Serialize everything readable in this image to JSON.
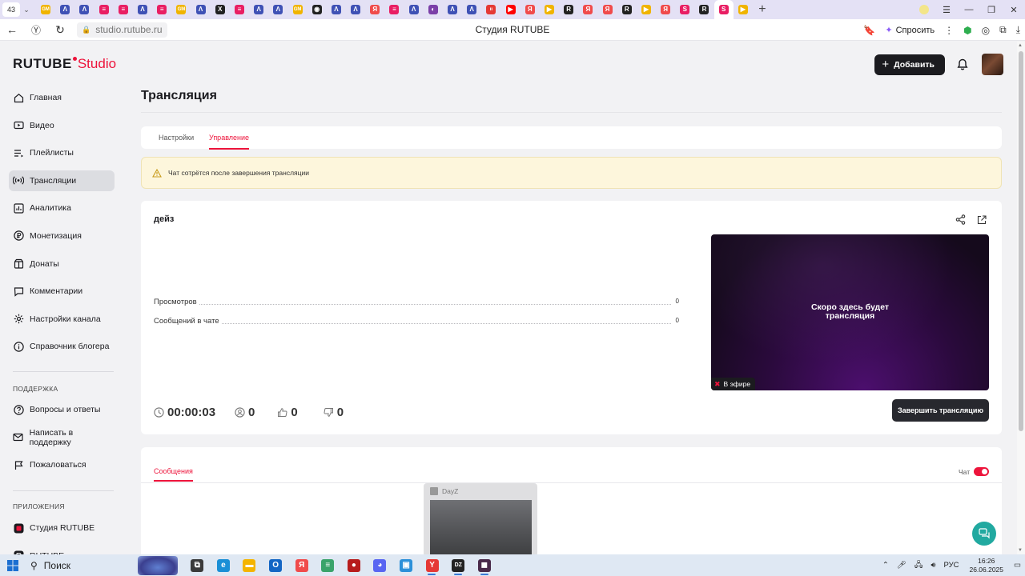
{
  "browser": {
    "tab_counter": "43",
    "tab_icons": [
      {
        "name": "gm-tab-icon",
        "color": "#f0b400",
        "glyph": "GM"
      },
      {
        "name": "dev-tab-icon",
        "color": "#3f51b5",
        "glyph": "Λ"
      },
      {
        "name": "dev-tab-icon",
        "color": "#3f51b5",
        "glyph": "Λ"
      },
      {
        "name": "rutube-tab-icon",
        "color": "#e91e63",
        "glyph": "≡"
      },
      {
        "name": "rutube-tab-icon",
        "color": "#e91e63",
        "glyph": "≡"
      },
      {
        "name": "dev-tab-icon",
        "color": "#3f51b5",
        "glyph": "Λ"
      },
      {
        "name": "rutube-tab-icon",
        "color": "#e91e63",
        "glyph": "≡"
      },
      {
        "name": "gm-tab-icon",
        "color": "#f0b400",
        "glyph": "GM"
      },
      {
        "name": "dev-tab-icon",
        "color": "#3f51b5",
        "glyph": "Λ"
      },
      {
        "name": "x-tab-icon",
        "color": "#222222",
        "glyph": "X"
      },
      {
        "name": "rutube-tab-icon",
        "color": "#e91e63",
        "glyph": "≡"
      },
      {
        "name": "dev-tab-icon",
        "color": "#3f51b5",
        "glyph": "Λ"
      },
      {
        "name": "dev-tab-icon",
        "color": "#3f51b5",
        "glyph": "Λ"
      },
      {
        "name": "gm-tab-icon",
        "color": "#f0b400",
        "glyph": "GM"
      },
      {
        "name": "github-tab-icon",
        "color": "#222222",
        "glyph": "◉"
      },
      {
        "name": "dev-tab-icon",
        "color": "#3f51b5",
        "glyph": "Λ"
      },
      {
        "name": "dev-tab-icon",
        "color": "#3f51b5",
        "glyph": "Λ"
      },
      {
        "name": "yandex-tab-icon",
        "color": "#f04b4b",
        "glyph": "Я"
      },
      {
        "name": "rutube-tab-icon",
        "color": "#e91e63",
        "glyph": "≡"
      },
      {
        "name": "dev-tab-icon",
        "color": "#3f51b5",
        "glyph": "Λ"
      },
      {
        "name": "app-tab-icon",
        "color": "#7b3fa8",
        "glyph": "◐"
      },
      {
        "name": "dev-tab-icon",
        "color": "#3f51b5",
        "glyph": "Λ"
      },
      {
        "name": "dev-tab-icon",
        "color": "#3f51b5",
        "glyph": "Λ"
      },
      {
        "name": "ivi-tab-icon",
        "color": "#e53935",
        "glyph": "ıı"
      },
      {
        "name": "youtube-tab-icon",
        "color": "#ff0000",
        "glyph": "▶"
      },
      {
        "name": "yandex-tab-icon",
        "color": "#f04b4b",
        "glyph": "Я"
      },
      {
        "name": "video-tab-icon",
        "color": "#f0b400",
        "glyph": "▶"
      },
      {
        "name": "r-tab-icon",
        "color": "#222222",
        "glyph": "R"
      },
      {
        "name": "yandex-tab-icon",
        "color": "#f04b4b",
        "glyph": "Я"
      },
      {
        "name": "yandex-tab-icon",
        "color": "#f04b4b",
        "glyph": "Я"
      },
      {
        "name": "r-tab-icon",
        "color": "#222222",
        "glyph": "R"
      },
      {
        "name": "video-tab-icon",
        "color": "#f0b400",
        "glyph": "▶"
      },
      {
        "name": "yandex-tab-icon",
        "color": "#f04b4b",
        "glyph": "Я"
      },
      {
        "name": "studio-tab-icon",
        "color": "#e91e63",
        "glyph": "S"
      },
      {
        "name": "r-tab-icon",
        "color": "#222222",
        "glyph": "R"
      },
      {
        "name": "studio-tab-icon",
        "color": "#e91e63",
        "glyph": "S",
        "active": true
      },
      {
        "name": "video-tab-icon",
        "color": "#f0b400",
        "glyph": "▶"
      }
    ],
    "url": "studio.rutube.ru",
    "page_title": "Студия RUTUBE",
    "ask_button": "Спросить"
  },
  "app": {
    "brand_main": "RUTUBE",
    "brand_sub": "Studio",
    "add_button": "Добавить",
    "sidebar": {
      "items": [
        {
          "label": "Главная",
          "icon": "home-icon"
        },
        {
          "label": "Видео",
          "icon": "video-icon"
        },
        {
          "label": "Плейлисты",
          "icon": "playlist-icon"
        },
        {
          "label": "Трансляции",
          "icon": "broadcast-icon",
          "active": true
        },
        {
          "label": "Аналитика",
          "icon": "analytics-icon"
        },
        {
          "label": "Монетизация",
          "icon": "ruble-icon"
        },
        {
          "label": "Донаты",
          "icon": "donate-icon"
        },
        {
          "label": "Комментарии",
          "icon": "comments-icon"
        },
        {
          "label": "Настройки канала",
          "icon": "gear-icon"
        },
        {
          "label": "Справочник блогера",
          "icon": "info-icon"
        }
      ],
      "support_heading": "ПОДДЕРЖКА",
      "support_items": [
        {
          "label": "Вопросы и ответы",
          "icon": "question-icon"
        },
        {
          "label": "Написать в поддержку",
          "icon": "mail-icon"
        },
        {
          "label": "Пожаловаться",
          "icon": "flag-icon"
        }
      ],
      "apps_heading": "ПРИЛОЖЕНИЯ",
      "apps_items": [
        {
          "label": "Студия RUTUBE",
          "icon": "studio-app-icon"
        },
        {
          "label": "RUTUBE",
          "icon": "rutube-app-icon"
        }
      ]
    },
    "page_title": "Трансляция",
    "tabs": [
      "Настройки",
      "Управление"
    ],
    "active_tab": "Управление",
    "warning": "Чат сотрётся после завершения трансляции",
    "stream": {
      "title": "дейз",
      "stats": [
        {
          "label": "Просмотров",
          "value": "0"
        },
        {
          "label": "Сообщений в чате",
          "value": "0"
        }
      ],
      "preview_text_line1": "Скоро здесь будет",
      "preview_text_line2": "трансляция",
      "live_badge": "В эфире",
      "duration": "00:00:03",
      "viewers": "0",
      "likes": "0",
      "dislikes": "0",
      "end_button": "Завершить трансляцию"
    },
    "messages": {
      "tab": "Сообщения",
      "chat_label": "Чат",
      "chat_enabled": true
    },
    "accent_color": "#ed143b"
  },
  "taskbar_preview": {
    "title": "DayZ"
  },
  "taskbar": {
    "search_label": "Поиск",
    "apps": [
      {
        "name": "task-view-icon",
        "color": "#3a3a3a",
        "glyph": "⧉"
      },
      {
        "name": "edge-icon",
        "color": "#1a8fd6",
        "glyph": "e"
      },
      {
        "name": "explorer-icon",
        "color": "#f4b400",
        "glyph": "▬"
      },
      {
        "name": "outlook-icon",
        "color": "#1366c4",
        "glyph": "O"
      },
      {
        "name": "yandex-icon",
        "color": "#f04b4b",
        "glyph": "Я"
      },
      {
        "name": "notepad-icon",
        "color": "#3aa36a",
        "glyph": "≡"
      },
      {
        "name": "app-icon",
        "color": "#b71c1c",
        "glyph": "●"
      },
      {
        "name": "discord-icon",
        "color": "#5865f2",
        "glyph": "◕"
      },
      {
        "name": "remote-icon",
        "color": "#2b90d9",
        "glyph": "▣"
      },
      {
        "name": "yandex-browser-icon",
        "color": "#e53935",
        "glyph": "Y",
        "active": true
      },
      {
        "name": "dayz-icon",
        "color": "#222222",
        "glyph": "DZ",
        "active": true
      },
      {
        "name": "game-icon",
        "color": "#4a2a4a",
        "glyph": "◼",
        "active": true
      }
    ],
    "lang": "РУС",
    "time": "16:26",
    "date": "26.06.2025"
  }
}
